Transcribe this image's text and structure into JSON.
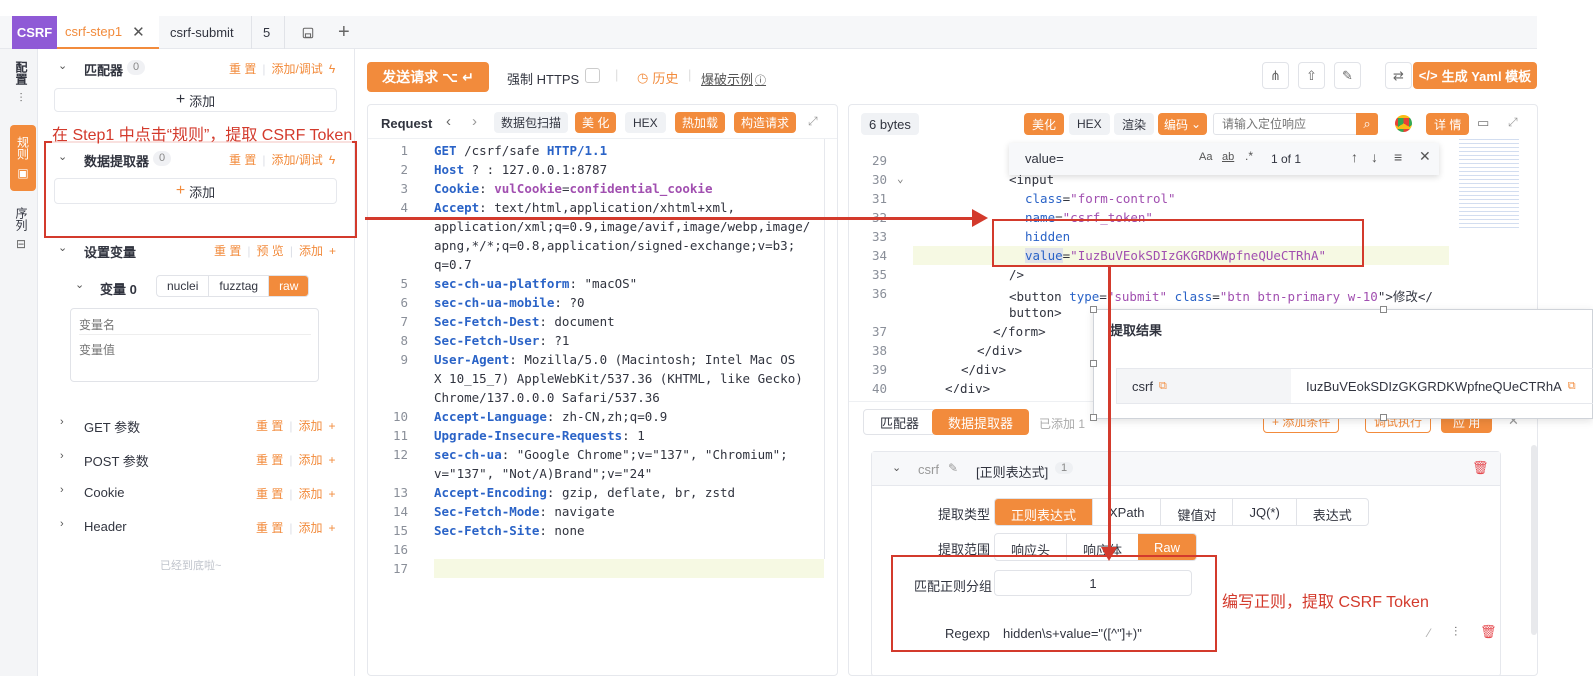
{
  "tabs": {
    "brand": "CSRF",
    "tab1": "csrf-step1",
    "tab2": "csrf-submit",
    "tab3": "5"
  },
  "side_strip": {
    "config": "配置",
    "rules": "规则",
    "sequence": "序列"
  },
  "left": {
    "matcher": {
      "title": "匹配器",
      "count": "0",
      "reset": "重 置",
      "add_debug": "添加/调试",
      "add": "添加"
    },
    "extractor": {
      "title": "数据提取器",
      "count": "0",
      "reset": "重 置",
      "add_debug": "添加/调试",
      "add": "添加"
    },
    "vars": {
      "title": "设置变量",
      "reset": "重 置",
      "preview": "预 览",
      "add": "添加",
      "var0": "变量 0",
      "modes": [
        "nuclei",
        "fuzztag",
        "raw"
      ],
      "name_placeholder": "变量名",
      "value_placeholder": "变量值"
    },
    "sections": [
      {
        "title": "GET 参数",
        "reset": "重 置",
        "add": "添加"
      },
      {
        "title": "POST 参数",
        "reset": "重 置",
        "add": "添加"
      },
      {
        "title": "Cookie",
        "reset": "重 置",
        "add": "添加"
      },
      {
        "title": "Header",
        "reset": "重 置",
        "add": "添加"
      }
    ],
    "bottom": "已经到底啦~"
  },
  "annotation1": "在 Step1 中点击“规则”，提取 CSRF Token",
  "annotation2": "编写正则，提取 CSRF Token",
  "toolbar": {
    "send": "发送请求 ⌥ ↵",
    "force_https": "强制 HTTPS",
    "history": "历史",
    "examples": "爆破示例",
    "yaml": "生成 Yaml 模板"
  },
  "request": {
    "title": "Request",
    "scan": "数据包扫描",
    "beautify": "美 化",
    "hex": "HEX",
    "hotload": "热加载",
    "build": "构造请求",
    "lines": [
      {
        "n": "1",
        "parts": [
          [
            "k",
            "GET"
          ],
          [
            "v",
            " /csrf/safe "
          ],
          [
            "k",
            "HTTP/1.1"
          ]
        ]
      },
      {
        "n": "2",
        "parts": [
          [
            "k",
            "Host"
          ],
          [
            "v",
            " ? : 127.0.0.1:8787"
          ]
        ]
      },
      {
        "n": "3",
        "parts": [
          [
            "k",
            "Cookie"
          ],
          [
            "v",
            ": "
          ],
          [
            "sv",
            "vulCookie"
          ],
          [
            "v",
            "="
          ],
          [
            "sv",
            "confidential_cookie"
          ]
        ]
      },
      {
        "n": "4",
        "parts": [
          [
            "k",
            "Accept"
          ],
          [
            "v",
            ": text/html,application/xhtml+xml,"
          ]
        ]
      },
      {
        "n": "",
        "parts": [
          [
            "v",
            "application/xml;q=0.9,image/avif,image/webp,image/"
          ]
        ]
      },
      {
        "n": "",
        "parts": [
          [
            "v",
            "apng,*/*;q=0.8,application/signed-exchange;v=b3;"
          ]
        ]
      },
      {
        "n": "",
        "parts": [
          [
            "v",
            "q=0.7"
          ]
        ]
      },
      {
        "n": "5",
        "parts": [
          [
            "k",
            "sec-ch-ua-platform"
          ],
          [
            "v",
            ": \"macOS\""
          ]
        ]
      },
      {
        "n": "6",
        "parts": [
          [
            "k",
            "sec-ch-ua-mobile"
          ],
          [
            "v",
            ": ?0"
          ]
        ]
      },
      {
        "n": "7",
        "parts": [
          [
            "k",
            "Sec-Fetch-Dest"
          ],
          [
            "v",
            ": document"
          ]
        ]
      },
      {
        "n": "8",
        "parts": [
          [
            "k",
            "Sec-Fetch-User"
          ],
          [
            "v",
            ": ?1"
          ]
        ]
      },
      {
        "n": "9",
        "parts": [
          [
            "k",
            "User-Agent"
          ],
          [
            "v",
            ": Mozilla/5.0 (Macintosh; Intel Mac OS"
          ]
        ]
      },
      {
        "n": "",
        "parts": [
          [
            "v",
            "X 10_15_7) AppleWebKit/537.36 (KHTML, like Gecko)"
          ]
        ]
      },
      {
        "n": "",
        "parts": [
          [
            "v",
            "Chrome/137.0.0.0 Safari/537.36"
          ]
        ]
      },
      {
        "n": "10",
        "parts": [
          [
            "k",
            "Accept-Language"
          ],
          [
            "v",
            ": zh-CN,zh;q=0.9"
          ]
        ]
      },
      {
        "n": "11",
        "parts": [
          [
            "k",
            "Upgrade-Insecure-Requests"
          ],
          [
            "v",
            ": 1"
          ]
        ]
      },
      {
        "n": "12",
        "parts": [
          [
            "k",
            "sec-ch-ua"
          ],
          [
            "v",
            ": \"Google Chrome\";v=\"137\", \"Chromium\";"
          ]
        ]
      },
      {
        "n": "",
        "parts": [
          [
            "v",
            "v=\"137\", \"Not/A)Brand\";v=\"24\""
          ]
        ]
      },
      {
        "n": "13",
        "parts": [
          [
            "k",
            "Accept-Encoding"
          ],
          [
            "v",
            ": gzip, deflate, br, zstd"
          ]
        ]
      },
      {
        "n": "14",
        "parts": [
          [
            "k",
            "Sec-Fetch-Mode"
          ],
          [
            "v",
            ": navigate"
          ]
        ]
      },
      {
        "n": "15",
        "parts": [
          [
            "k",
            "Sec-Fetch-Site"
          ],
          [
            "v",
            ": none"
          ]
        ]
      },
      {
        "n": "16",
        "parts": []
      },
      {
        "n": "17",
        "parts": []
      }
    ]
  },
  "response": {
    "bytes": "6 bytes",
    "beautify": "美化",
    "hex": "HEX",
    "render": "渲染",
    "encoding": "编码",
    "search_placeholder": "请输入定位响应",
    "detail": "详 情",
    "find_value": "value=",
    "find_count": "1 of 1",
    "lines": [
      {
        "n": "29",
        "parts": []
      },
      {
        "n": "30",
        "parts": [
          [
            "tag",
            "<input"
          ]
        ]
      },
      {
        "n": "31",
        "parts": [
          [
            "attr",
            "class"
          ],
          [
            "tag",
            "="
          ],
          [
            "str",
            "\"form-control\""
          ]
        ]
      },
      {
        "n": "32",
        "parts": [
          [
            "attr",
            "name"
          ],
          [
            "tag",
            "="
          ],
          [
            "str",
            "\"csrf_token\""
          ]
        ]
      },
      {
        "n": "33",
        "parts": [
          [
            "attr",
            "hidden"
          ]
        ]
      },
      {
        "n": "34",
        "parts": [
          [
            "attr",
            "value"
          ],
          [
            "tag",
            "="
          ],
          [
            "str",
            "\"IuzBuVEokSDIzGKGRDKWpfneQUeCTRhA\""
          ]
        ]
      },
      {
        "n": "35",
        "parts": [
          [
            "tag",
            "/>"
          ]
        ]
      },
      {
        "n": "36",
        "parts": [
          [
            "tag",
            "<button "
          ],
          [
            "attr",
            "type"
          ],
          [
            "tag",
            "="
          ],
          [
            "str",
            "\"submit\" "
          ],
          [
            "attr",
            "class"
          ],
          [
            "tag",
            "="
          ],
          [
            "str",
            "\"btn btn-primary w-10"
          ],
          [
            "tag",
            "\">修改</"
          ]
        ]
      },
      {
        "n": "",
        "parts": [
          [
            "tag",
            "button>"
          ]
        ]
      },
      {
        "n": "37",
        "parts": [
          [
            "tag",
            "</form>"
          ]
        ]
      },
      {
        "n": "38",
        "parts": [
          [
            "tag",
            "</div>"
          ]
        ]
      },
      {
        "n": "39",
        "parts": [
          [
            "tag",
            "</div>"
          ]
        ]
      },
      {
        "n": "40",
        "parts": [
          [
            "tag",
            "</div>"
          ]
        ]
      }
    ]
  },
  "result_popup": {
    "title": "提取结果",
    "key": "csrf",
    "value": "IuzBuVEokSDIzGKGRDKWpfneQUeCTRhA"
  },
  "extract_panel": {
    "tab_matcher": "匹配器",
    "tab_extractor": "数据提取器",
    "added": "已添加 1",
    "add_condition": "添加条件",
    "debug": "调试执行",
    "apply": "应 用",
    "item_name": "csrf",
    "item_type": "[正则表达式]",
    "item_count": "1",
    "type_label": "提取类型",
    "types": [
      "正则表达式",
      "XPath",
      "键值对",
      "JQ(*)",
      "表达式"
    ],
    "scope_label": "提取范围",
    "scopes": [
      "响应头",
      "响应体",
      "Raw"
    ],
    "group_label": "匹配正则分组",
    "group_value": "1",
    "regexp_label": "Regexp",
    "regexp_value": "hidden\\s+value=\"([^\"]+)\""
  }
}
